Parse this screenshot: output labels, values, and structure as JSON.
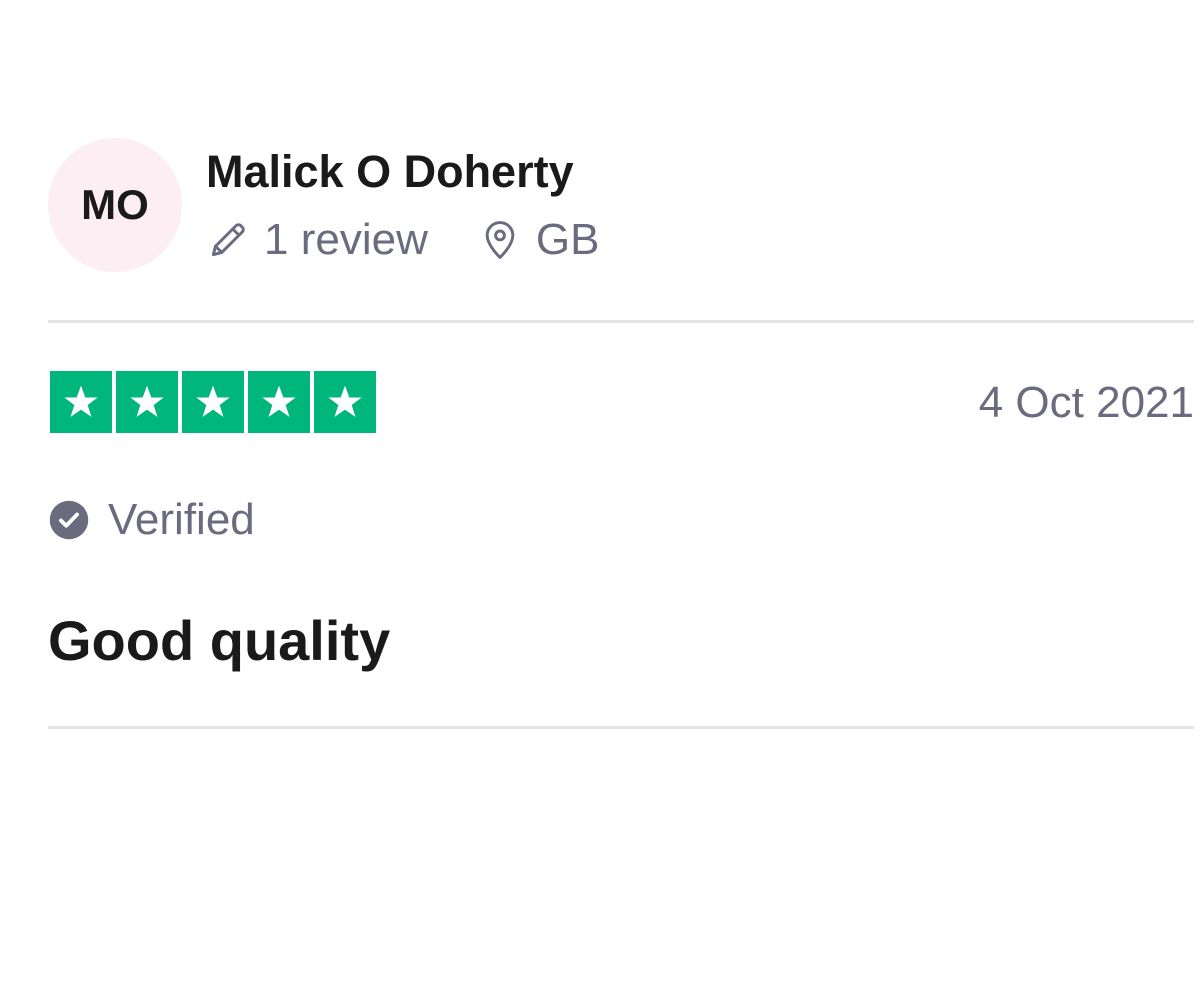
{
  "reviewer": {
    "initials": "MO",
    "name": "Malick O Doherty",
    "review_count": "1 review",
    "country": "GB",
    "avatar_color": "#fdeef3"
  },
  "rating": {
    "stars": 5,
    "max_stars": 5,
    "star_color": "#00b67a"
  },
  "review": {
    "date": "4 Oct 2021",
    "verified_label": "Verified",
    "title": "Good quality"
  },
  "icons": {
    "review_count": "pencil-icon",
    "country": "location-pin-icon",
    "verified": "check-circle-icon",
    "star": "star-icon"
  }
}
